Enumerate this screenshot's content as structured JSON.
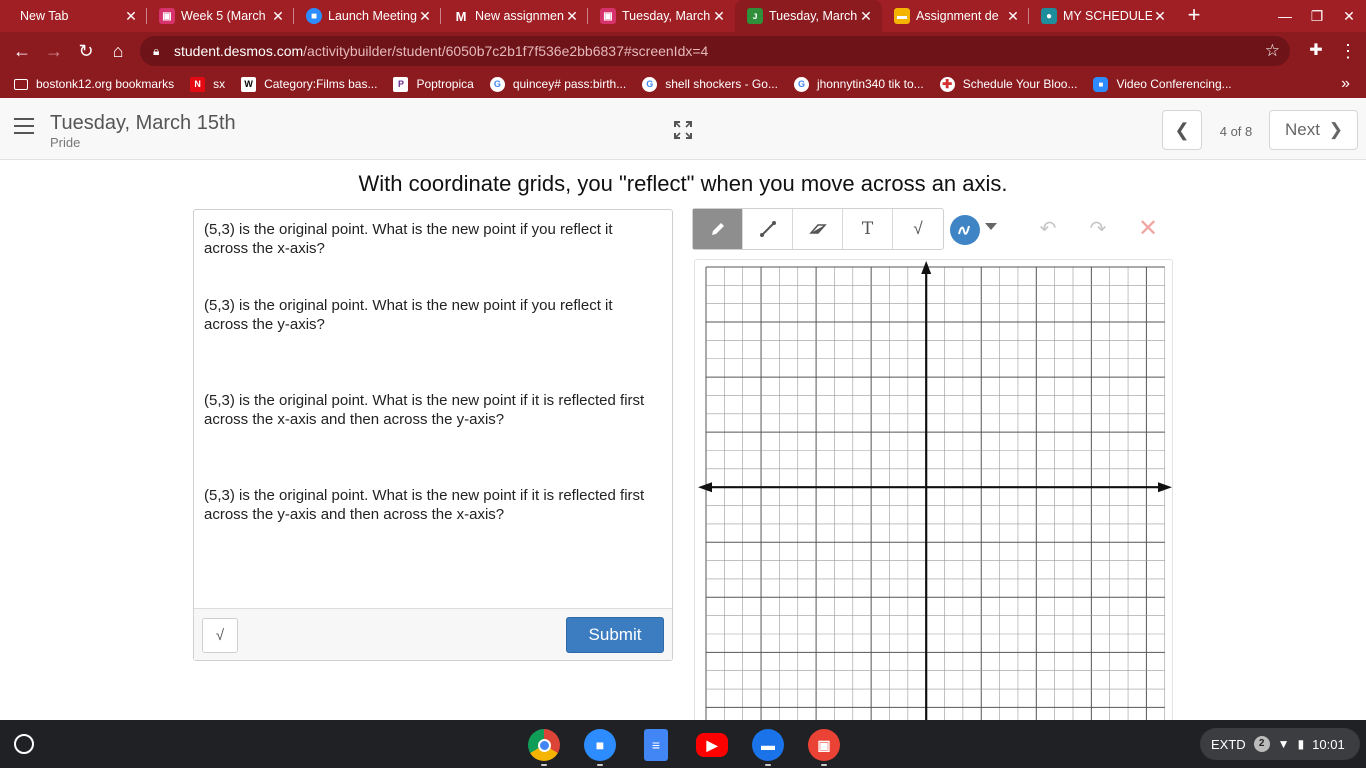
{
  "browser": {
    "tabs": [
      {
        "title": "New Tab",
        "icon": "none",
        "color": ""
      },
      {
        "title": "Week 5 (March",
        "icon": "presentation-icon",
        "color": "#d6336c"
      },
      {
        "title": "Launch Meeting",
        "icon": "zoom-icon",
        "color": "#2d8cff"
      },
      {
        "title": "New assignmen",
        "icon": "gmail-icon",
        "color": "#ffffff"
      },
      {
        "title": "Tuesday, March",
        "icon": "presentation-icon",
        "color": "#d6336c"
      },
      {
        "title": "Tuesday, March",
        "icon": "desmos-icon",
        "color": "#2f8f3a",
        "active": true
      },
      {
        "title": "Assignment de",
        "icon": "slides-icon",
        "color": "#f4b400"
      },
      {
        "title": "MY SCHEDULE",
        "icon": "classroom-icon",
        "color": "#1e8e9c"
      }
    ],
    "url_host": "student.desmos.com",
    "url_path": "/activitybuilder/student/6050b7c2b1f7f536e2bb6837#screenIdx=4",
    "bookmarks": [
      {
        "label": "bostonk12.org bookmarks",
        "icon": "folder-icon"
      },
      {
        "label": "sx",
        "icon": "netflix-icon"
      },
      {
        "label": "Category:Films bas...",
        "icon": "wikipedia-icon"
      },
      {
        "label": "Poptropica",
        "icon": "poptropica-icon"
      },
      {
        "label": "quincey# pass:birth...",
        "icon": "google-icon"
      },
      {
        "label": "shell shockers - Go...",
        "icon": "google-icon"
      },
      {
        "label": "jhonnytin340 tik to...",
        "icon": "google-icon"
      },
      {
        "label": "Schedule Your Bloo...",
        "icon": "redcross-icon"
      },
      {
        "label": "Video Conferencing...",
        "icon": "zoom-icon"
      }
    ]
  },
  "header": {
    "title": "Tuesday, March 15th",
    "subtitle": "Pride",
    "page_count": "4 of 8",
    "next_label": "Next"
  },
  "screen": {
    "title": "With coordinate grids, you \"reflect\" when you move across an axis.",
    "questions": [
      "(5,3) is the original point. What is the new point if you reflect it across the x-axis?",
      "(5,3) is the original point. What is the new point if you reflect it across the y-axis?",
      "(5,3) is the original point. What is the new point if it is reflected first across the x-axis and then across the y-axis?",
      "(5,3) is the original point. What is the new point if it is reflected first across the y-axis and then across the x-axis?"
    ],
    "submit_label": "Submit",
    "math_label": "√"
  },
  "sketch": {
    "tools": [
      "pencil-icon",
      "line-icon",
      "eraser-icon",
      "text-icon",
      "math-icon"
    ],
    "text_tool_label": "T",
    "accent": "#3f84c4"
  },
  "shelf": {
    "tray_label": "EXTD",
    "notification_count": "2",
    "time": "10:01"
  }
}
